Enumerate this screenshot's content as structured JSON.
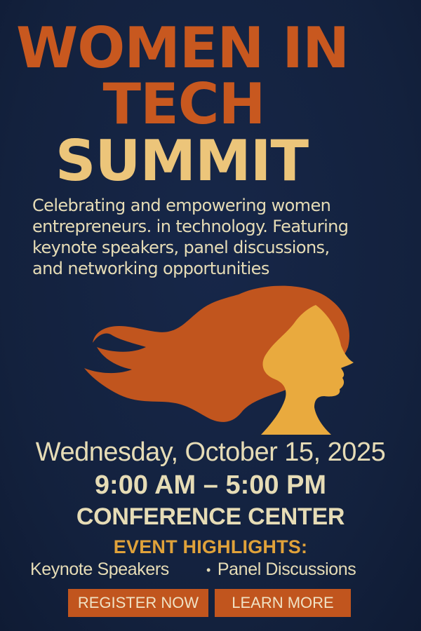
{
  "poster": {
    "title_line1": "WOMEN IN",
    "title_line2": "TECH",
    "title_line3": "SUMMIT",
    "description": "Celebrating and empowering women\nentrepreneurs. in technology. Featuring\nkeynote speakers, panel discussions,\nand networking opportunities",
    "date": "Wednesday, October 15, 2025",
    "time": "9:00 AM – 5:00 PM",
    "venue": "CONFERENCE CENTER",
    "highlights_heading": "EVENT HIGHLIGHTS:",
    "highlights": [
      "Keynote Speakers",
      "Panel Discussions"
    ],
    "bullet": "•",
    "buttons": {
      "register": "REGISTER NOW",
      "learn_more": "LEARN MORE"
    }
  },
  "colors": {
    "background": "#13213d",
    "title_orange": "#c8581f",
    "title_gold": "#ecc57a",
    "text_cream": "#e6dcb6",
    "highlight_amber": "#e0a23a",
    "button_orange": "#c1551e",
    "hair": "#c1551e",
    "face": "#e9aa3e"
  },
  "illustration": {
    "icon": "woman-profile-flowing-hair-icon"
  }
}
